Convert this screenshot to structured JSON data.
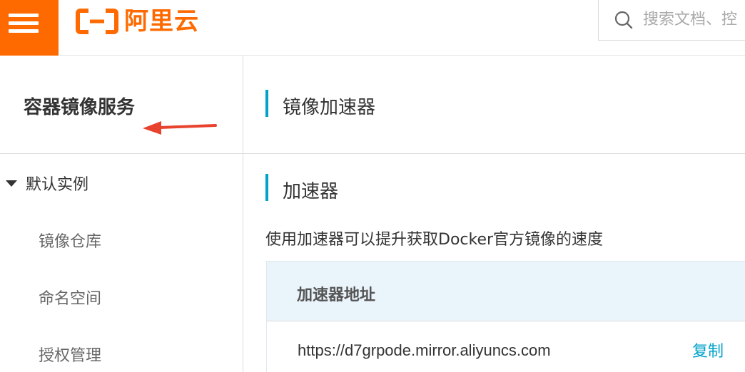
{
  "header": {
    "logo_text": "阿里云",
    "search_placeholder": "搜索文档、控"
  },
  "sidebar": {
    "title": "容器镜像服务",
    "group_label": "默认实例",
    "items": [
      {
        "label": "镜像仓库"
      },
      {
        "label": "命名空间"
      },
      {
        "label": "授权管理"
      }
    ]
  },
  "main": {
    "page_title": "镜像加速器",
    "section_title": "加速器",
    "description": "使用加速器可以提升获取Docker官方镜像的速度",
    "table": {
      "header": "加速器地址",
      "url": "https://d7grpode.mirror.aliyuncs.com",
      "copy_label": "复制"
    }
  },
  "colors": {
    "brand": "#ff6a00",
    "accent": "#00a2ca",
    "annotation_arrow": "#e8432e"
  }
}
